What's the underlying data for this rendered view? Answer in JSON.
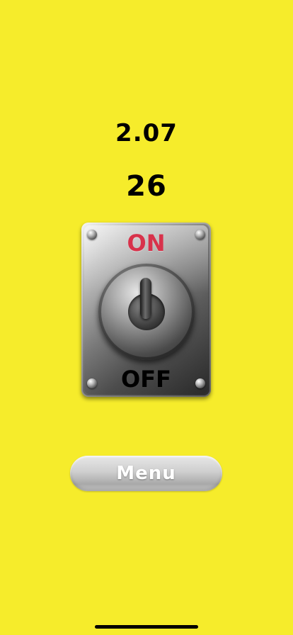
{
  "stats": {
    "timer": "2.07",
    "score": "26"
  },
  "switch": {
    "on_label": "ON",
    "off_label": "OFF",
    "state": "on"
  },
  "menu": {
    "label": "Menu"
  },
  "colors": {
    "background": "#f6ec2b",
    "on_label": "#d8324b",
    "off_label": "#000000"
  }
}
